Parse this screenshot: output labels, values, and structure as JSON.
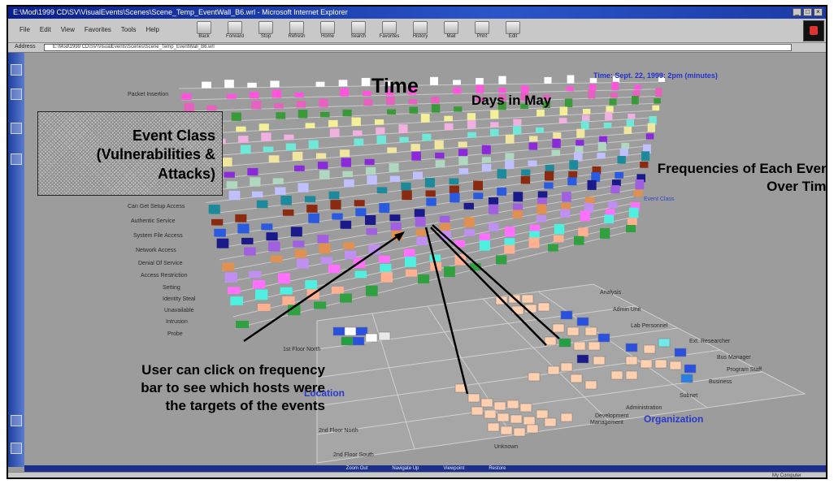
{
  "window": {
    "title": "E:\\Mod\\1999 CD\\SV\\VisualEvents\\Scenes\\Scene_Temp_EventWall_B6.wrl - Microsoft Internet Explorer"
  },
  "menu": [
    "File",
    "Edit",
    "View",
    "Favorites",
    "Tools",
    "Help"
  ],
  "toolbar": [
    "Back",
    "Forward",
    "Stop",
    "Refresh",
    "Home",
    "Search",
    "Favorites",
    "History",
    "Mail",
    "Print",
    "Edit"
  ],
  "address": {
    "label": "Address",
    "value": "E:\\Mod\\1999 CD\\SV\\VisualEvents\\Scenes\\Scene_Temp_EventWall_B6.wrl"
  },
  "scene": {
    "time_caption": "Time: Sept. 22, 1999: 2pm (minutes)",
    "title_time": "Time",
    "title_days": "Days in May",
    "event_class": "Event Class (Vulnerabilities & Attacks)",
    "frequencies": "Frequencies of Each Event Over Time",
    "event_class_tag": "Event Class",
    "user_note": "User can click on frequency bar to see which hosts were the targets of the events",
    "location_label": "Location",
    "organization_label": "Organization",
    "row_labels": [
      "Packet Insertion",
      "Can Get Setup Access",
      "Authentic Service",
      "System File Access",
      "Network Access",
      "Denial Of Service",
      "Access Restriction",
      "Setting",
      "Identity Steal",
      "Unavailable",
      "Intrusion",
      "Probe"
    ],
    "floor_labels": [
      "1st Floor North",
      "2nd Floor North",
      "2nd Floor South",
      "Unknown"
    ],
    "org_labels": [
      "Analysis",
      "Admin Unit",
      "Lab Personnel",
      "Ext. Researcher",
      "Bus Manager",
      "Program Staff",
      "Business",
      "Administration",
      "Subnet",
      "Development",
      "Management"
    ]
  },
  "bottombar": [
    "Zoom Out",
    "Navigate Up",
    "Viewpoint",
    "Restore"
  ],
  "status": {
    "zone": "My Computer"
  },
  "colors": {
    "annotation_blue": "#2a39c9",
    "panel_gray": "#9c9c9c",
    "strip_blue": "#1d3fa0"
  }
}
